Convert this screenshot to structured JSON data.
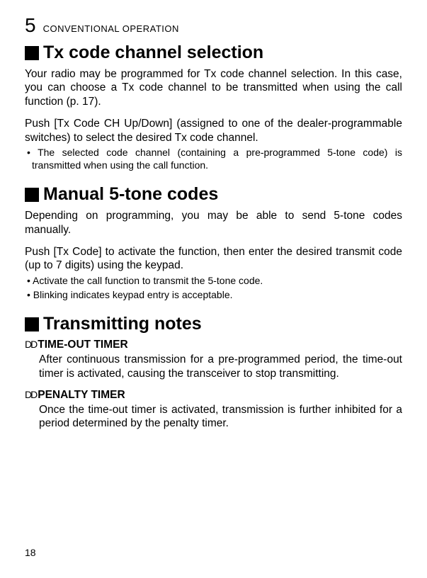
{
  "header": {
    "chapter_number": "5",
    "chapter_title": "CONVENTIONAL OPERATION"
  },
  "section1": {
    "title": "Tx code channel selection",
    "p1": "Your radio may be programmed for Tx code channel selection. In this case, you can choose a Tx code channel to be transmitted when using the call function (p. 17).",
    "p2": "Push [Tx Code CH Up/Down] (assigned to one of the dealer-programmable switches) to select the desired Tx code channel.",
    "b1": "• The selected code channel (containing a pre-programmed 5-tone code) is transmitted when using the call function."
  },
  "section2": {
    "title": "Manual 5-tone codes",
    "p1": "Depending on programming, you may be able to send 5-tone codes manually.",
    "p2": "Push [Tx Code] to activate the function, then enter the desired transmit code (up to 7 digits) using the keypad.",
    "b1": "• Activate the call function to transmit the 5-tone code.",
    "b2": "• Blinking indicates keypad entry is acceptable."
  },
  "section3": {
    "title": "Transmitting notes",
    "sub1": {
      "marker": "DD",
      "title": "TIME-OUT TIMER",
      "body": "After continuous transmission for a pre-programmed period, the time-out timer is activated, causing the transceiver to stop transmitting."
    },
    "sub2": {
      "marker": "DD",
      "title": "PENALTY TIMER",
      "body": "Once the time-out timer is activated, transmission is further inhibited for a period determined by the penalty timer."
    }
  },
  "page_number": "18"
}
